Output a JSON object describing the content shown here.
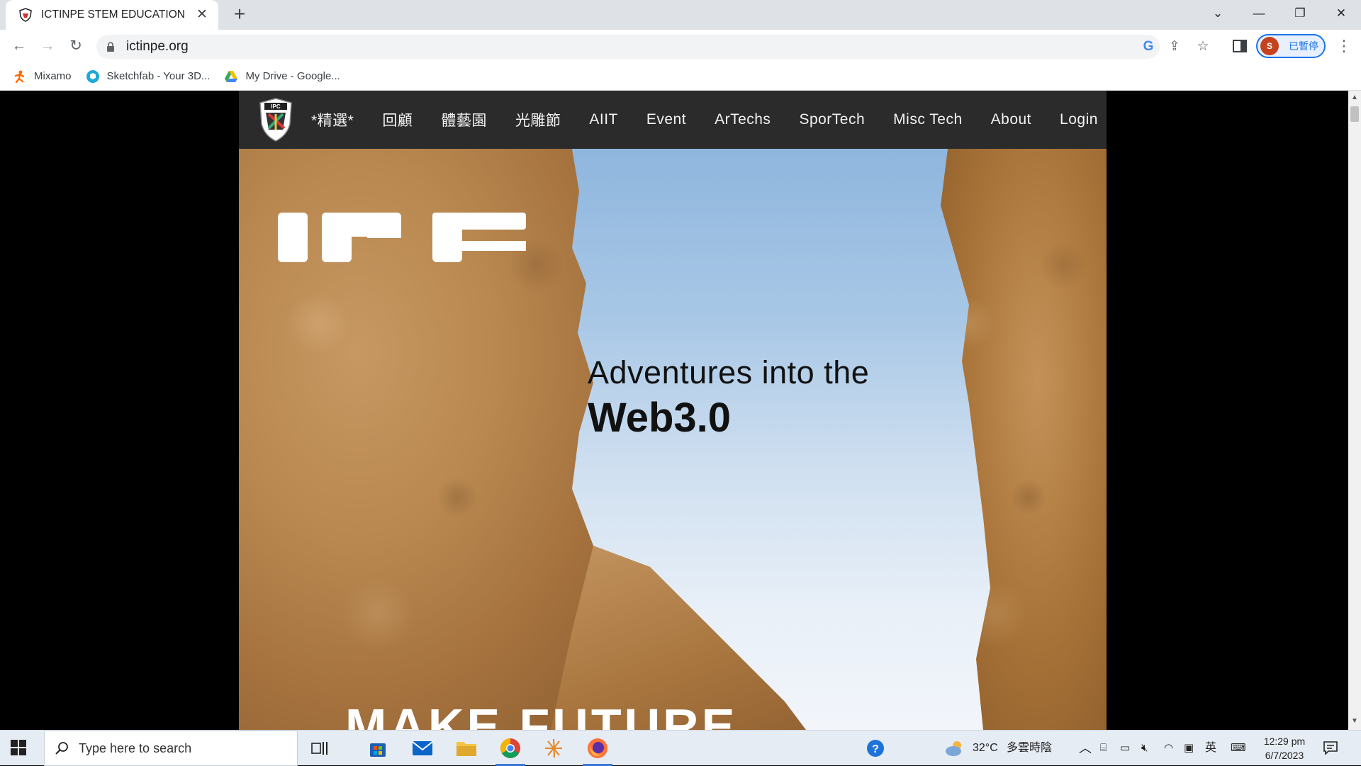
{
  "browser": {
    "tab_title": "ICTINPE STEM EDUCATION",
    "new_tab_symbol": "+",
    "url": "ictinpe.org",
    "profile_initial": "S",
    "profile_label": "已暫停",
    "bookmarks": [
      {
        "label": "Mixamo",
        "icon": "mixamo-icon",
        "color": "#ff6a00"
      },
      {
        "label": "Sketchfab - Your 3D...",
        "icon": "sketchfab-icon",
        "color": "#1caad9"
      },
      {
        "label": "My Drive - Google...",
        "icon": "google-drive-icon",
        "color": "#34a853"
      }
    ]
  },
  "site": {
    "menu": [
      "*精選*",
      "回顧",
      "體藝園",
      "光雕節",
      "AIIT",
      "Event",
      "ArTechs",
      "SporTech",
      "Misc Tech",
      "About",
      "Login"
    ],
    "hero": {
      "line1": "Adventures into the",
      "line2": "Web3.0",
      "bottom_text": "MAKE FUTURE"
    }
  },
  "taskbar": {
    "search_placeholder": "Type here to search",
    "weather_temp": "32°C",
    "weather_text": "多雲時陰",
    "ime": "英",
    "time": "12:29 pm",
    "date": "6/7/2023"
  },
  "colors": {
    "site_nav_bg": "#2b2b2b",
    "accent_blue": "#1a73e8"
  }
}
